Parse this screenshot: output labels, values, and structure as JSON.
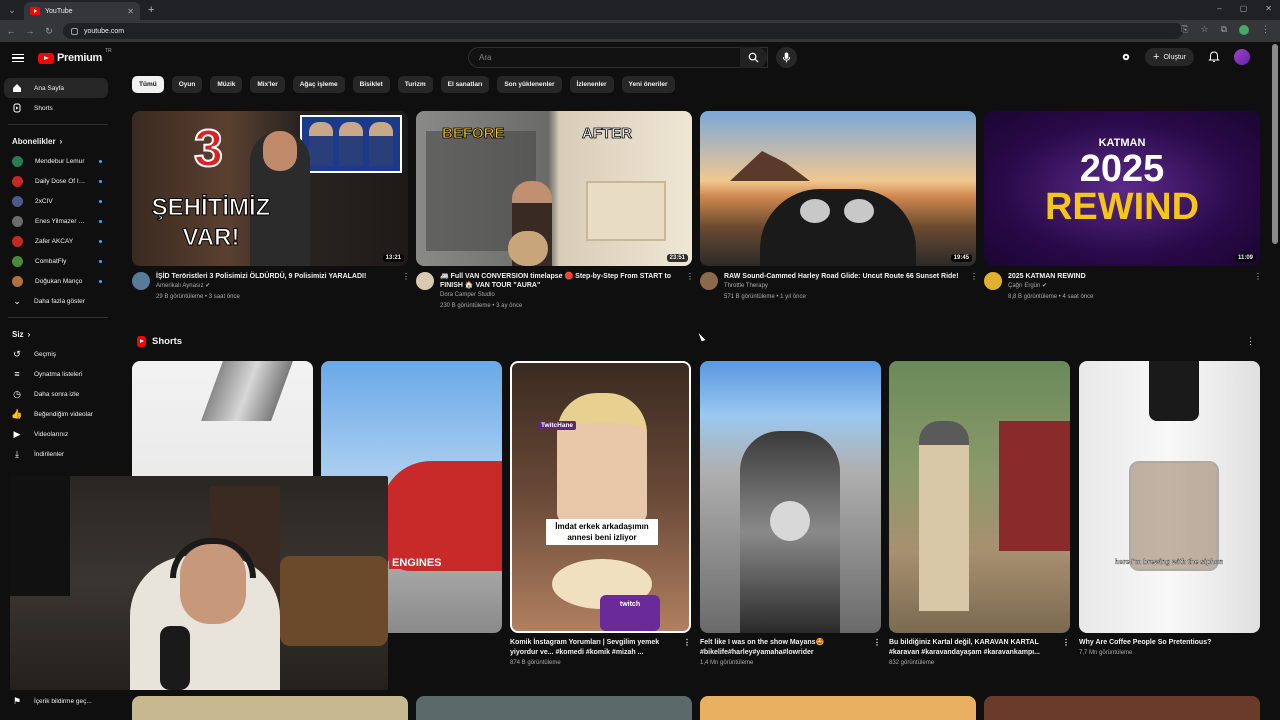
{
  "browser": {
    "tab_title": "YouTube",
    "url": "youtube.com"
  },
  "masthead": {
    "logo_text": "Premium",
    "logo_tr": "TR",
    "search_placeholder": "Ara",
    "create_label": "Oluştur"
  },
  "sidebar": {
    "main": [
      {
        "label": "Ana Sayfa",
        "icon": "home-icon"
      },
      {
        "label": "Shorts",
        "icon": "shorts-icon"
      }
    ],
    "subs_header": "Abonelikler",
    "subscriptions": [
      {
        "name": "Mendebur Lemur",
        "color": "#2a7d4f"
      },
      {
        "name": "Daily Dose Of Int...",
        "color": "#c62828"
      },
      {
        "name": "2xCIV",
        "color": "#4a5a8a"
      },
      {
        "name": "Enes Yilmazer Türki...",
        "color": "#6b6b6b"
      },
      {
        "name": "Zafer AKCAY",
        "color": "#c62828"
      },
      {
        "name": "CombatFly",
        "color": "#4a8a3a"
      },
      {
        "name": "Doğukan Manço",
        "color": "#b07040"
      }
    ],
    "show_more": "Daha fazla göster",
    "you_header": "Siz",
    "you_items": [
      {
        "label": "Geçmiş",
        "icon": "history-icon"
      },
      {
        "label": "Oynatma listeleri",
        "icon": "playlist-icon"
      },
      {
        "label": "Daha sonra izle",
        "icon": "watch-later-icon"
      },
      {
        "label": "Beğendiğim videolar",
        "icon": "like-icon"
      },
      {
        "label": "Videolarınız",
        "icon": "your-videos-icon"
      },
      {
        "label": "İndirilenler",
        "icon": "download-icon"
      }
    ],
    "bottom_item": "İçerik bildirme geç..."
  },
  "chips": [
    "Tümü",
    "Oyun",
    "Müzik",
    "Mix'ler",
    "Ağaç işleme",
    "Bisiklet",
    "Turizm",
    "El sanatları",
    "Son yüklenenler",
    "İzlenenler",
    "Yeni öneriler"
  ],
  "videos": [
    {
      "title": "İŞİD Teröristleri 3 Polisimizi ÖLDÜRDÜ, 9 Polisimizi YARALADI!",
      "channel": "Amerikalı Aynasız",
      "verified": true,
      "stats": "29 B görüntüleme • 3 saat önce",
      "duration": "13:21",
      "thumb_text_1": "3",
      "thumb_text_2": "ŞEHİTİMİZ VAR!"
    },
    {
      "title": "🚐 Full VAN CONVERSION timelapse 🛑 Step-by-Step From START to FINISH 🏠 VAN TOUR \"AURA\"",
      "channel": "Dora Camper Studio",
      "verified": false,
      "stats": "230 B görüntüleme • 3 ay önce",
      "duration": "23:51",
      "thumb_text_1": "BEFORE",
      "thumb_text_2": "AFTER"
    },
    {
      "title": "RAW Sound-Cammed Harley Road Glide: Uncut Route 66 Sunset Ride!",
      "channel": "Throttle Therapy",
      "verified": false,
      "stats": "571 B görüntüleme • 1 yıl önce",
      "duration": "19:45"
    },
    {
      "title": "2025 KATMAN REWIND",
      "channel": "Çağrı Ergün",
      "verified": true,
      "stats": "8,8 B görüntüleme • 4 saat önce",
      "duration": "11:09",
      "thumb_text_1": "KATMAN",
      "thumb_text_2": "2025",
      "thumb_text_3": "REWIND"
    }
  ],
  "shorts_header": "Shorts",
  "shorts": [
    {
      "title": "",
      "views": ""
    },
    {
      "title": "",
      "views": "",
      "overlay": "ENGINES"
    },
    {
      "title": "Komik İnstagram Yorumları | Sevgilim yemek yiyordur ve... #komedi #komik #mizah ...",
      "views": "874 B görüntüleme",
      "overlay": "İmdat erkek arkadaşımın annesi beni izliyor",
      "badge": "TwitcHane",
      "watermark": "twitch"
    },
    {
      "title": "Felt like I was on the show Mayans🤩 #bikelife#harley#yamaha#lowrider",
      "views": "1,4 Mn görüntüleme"
    },
    {
      "title": "Bu bildiğiniz Kartal değil, KARAVAN KARTAL #karavan #karavandayaşam #karavankampı...",
      "views": "832 görüntüleme"
    },
    {
      "title": "Why Are Coffee People So Pretentious?",
      "views": "7,7 Mn görüntüleme",
      "overlay": "here I'm brewing with the siphon"
    }
  ]
}
